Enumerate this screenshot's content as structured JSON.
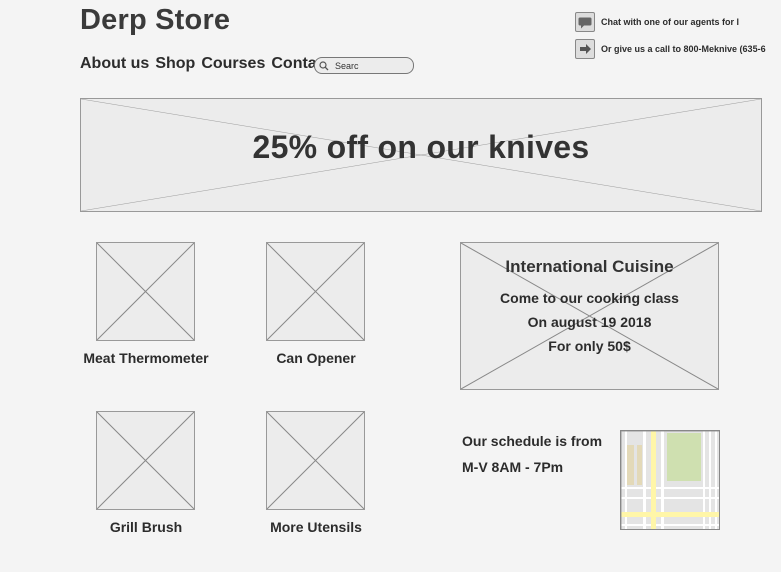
{
  "header": {
    "store_title": "Derp Store",
    "nav": [
      "About us",
      "Shop",
      "Courses",
      "Contact"
    ],
    "search": {
      "value": "Searc",
      "icon": "search-icon"
    },
    "contact": {
      "chat_text": "Chat with one of our agents for l",
      "chat_icon": "chat-bubble-icon",
      "call_text": "Or give us a call to 800-Meknive (635-6",
      "call_icon": "arrow-right-icon"
    }
  },
  "banner": {
    "text": "25% off on our knives"
  },
  "products": [
    {
      "label": "Meat Thermometer"
    },
    {
      "label": "Can Opener"
    },
    {
      "label": "Grill Brush"
    },
    {
      "label": "More Utensils"
    }
  ],
  "promo": {
    "title": "International Cuisine",
    "line1": "Come to our cooking class",
    "line2": "On august 19 2018",
    "line3": "For only 50$"
  },
  "schedule": {
    "line1": "Our schedule is from",
    "line2": "M-V 8AM - 7Pm"
  },
  "colors": {
    "background": "#f4f4f4",
    "placeholder": "#ececec",
    "map_road": "#fff6a8",
    "map_park": "#cfe0b0"
  }
}
